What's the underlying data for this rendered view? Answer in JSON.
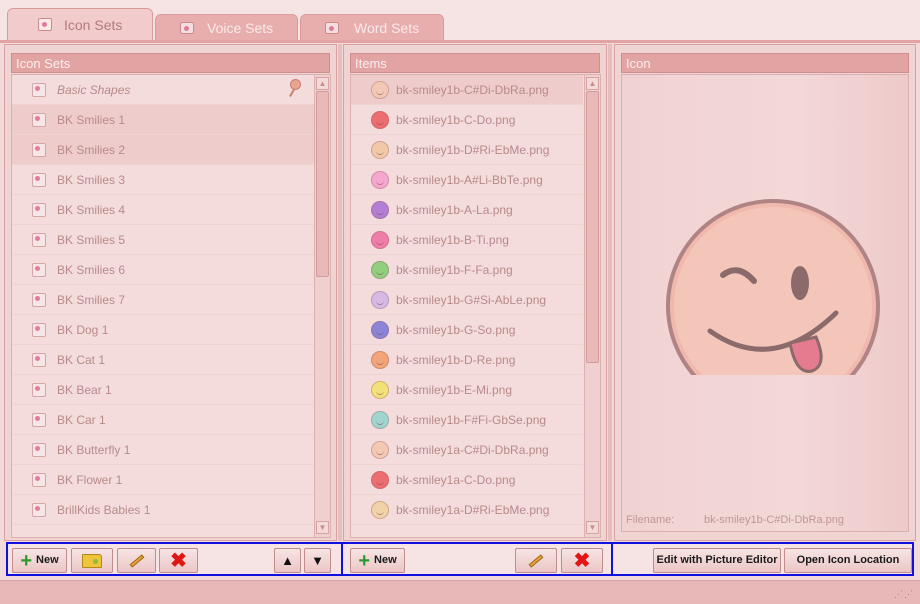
{
  "tabs": [
    {
      "label": "Icon Sets",
      "icon": "icon-sets-icon",
      "active": true
    },
    {
      "label": "Voice Sets",
      "icon": "speaker-icon",
      "active": false
    },
    {
      "label": "Word Sets",
      "icon": "word-icon",
      "active": false
    }
  ],
  "icon_sets": {
    "header": "Icon Sets",
    "items": [
      "Basic Shapes",
      "BK Smilies 1",
      "BK Smilies 2",
      "BK Smilies 3",
      "BK Smilies 4",
      "BK Smilies 5",
      "BK Smilies 6",
      "BK Smilies 7",
      "BK Dog 1",
      "BK Cat 1",
      "BK Bear 1",
      "BK Car 1",
      "BK Butterfly 1",
      "BK Flower 1",
      "BrillKids Babies 1"
    ]
  },
  "items": {
    "header": "Items",
    "list": [
      {
        "name": "bk-smiley1b-C#Di-DbRa.png",
        "color": "#f3c9b6"
      },
      {
        "name": "bk-smiley1b-C-Do.png",
        "color": "#ec6d72"
      },
      {
        "name": "bk-smiley1b-D#Ri-EbMe.png",
        "color": "#f2c9a8"
      },
      {
        "name": "bk-smiley1b-A#Li-BbTe.png",
        "color": "#f4a7cf"
      },
      {
        "name": "bk-smiley1b-A-La.png",
        "color": "#b37ed4"
      },
      {
        "name": "bk-smiley1b-B-Ti.png",
        "color": "#ee7ea8"
      },
      {
        "name": "bk-smiley1b-F-Fa.png",
        "color": "#8fcf7e"
      },
      {
        "name": "bk-smiley1b-G#Si-AbLe.png",
        "color": "#d7b9e6"
      },
      {
        "name": "bk-smiley1b-G-So.png",
        "color": "#8b84d8"
      },
      {
        "name": "bk-smiley1b-D-Re.png",
        "color": "#f2a57a"
      },
      {
        "name": "bk-smiley1b-E-Mi.png",
        "color": "#f2e07a"
      },
      {
        "name": "bk-smiley1b-F#Fi-GbSe.png",
        "color": "#9fd4cf"
      },
      {
        "name": "bk-smiley1a-C#Di-DbRa.png",
        "color": "#f3c9b6"
      },
      {
        "name": "bk-smiley1a-C-Do.png",
        "color": "#ec6d72"
      },
      {
        "name": "bk-smiley1a-D#Ri-EbMe.png",
        "color": "#f2d2a8"
      }
    ]
  },
  "icon_panel": {
    "header": "Icon",
    "filename_label": "Filename:",
    "filename_value": "bk-smiley1b-C#Di-DbRa.png"
  },
  "toolbar": {
    "new_label": "New",
    "items_new_label": "New",
    "edit_picture_label": "Edit with Picture Editor",
    "open_location_label": "Open Icon Location"
  }
}
